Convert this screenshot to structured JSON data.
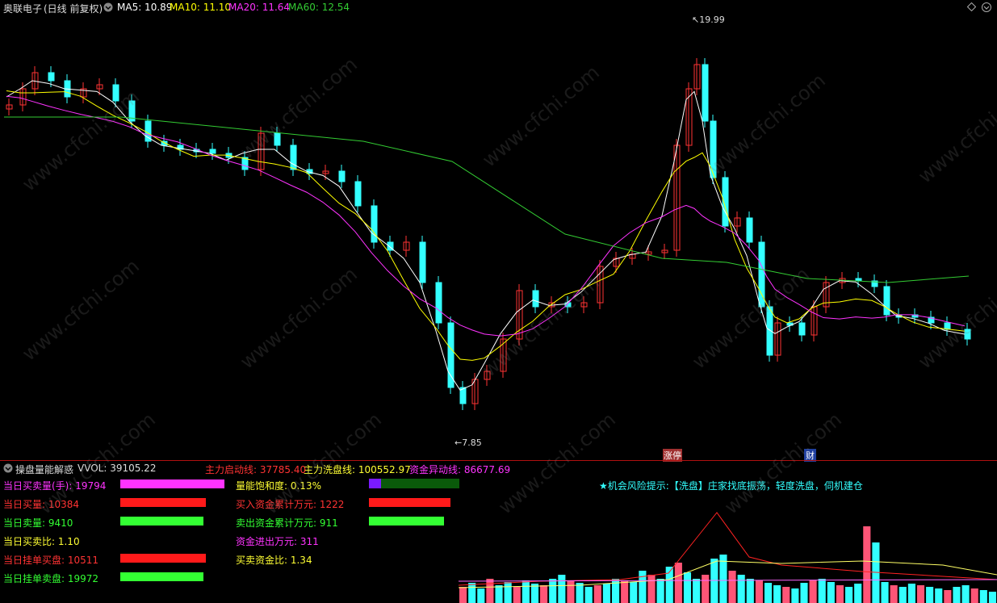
{
  "header": {
    "stock_name": "奥联电子",
    "period": "(日线 前复权)",
    "ma5": "MA5: 10.89",
    "ma10": "MA10: 11.10",
    "ma20": "MA20: 11.64",
    "ma60": "MA60: 12.54",
    "colors": {
      "ma5": "#ffffff",
      "ma10": "#ffff00",
      "ma20": "#ff33ff",
      "ma60": "#33cc33",
      "up": "#ff3333",
      "down": "#33ffff"
    }
  },
  "main_chart": {
    "high_label": "19.99",
    "low_label": "7.85",
    "event_tags": [
      "涨停",
      "财"
    ]
  },
  "indicator": {
    "name": "操盘量能解惑",
    "vvol": "VVOL: 39105.22",
    "zhuli_qidong": "主力启动线: 37785.40",
    "zhuli_xipan": "主力洗盘线: 100552.97",
    "zijin_yidong": "资金异动线: 86677.69"
  },
  "stats_left": [
    {
      "label": "当日买卖量(手): 19794",
      "color": "#ff33ff",
      "bar_color": "#ff33ff",
      "bar_fraction": 1.0
    },
    {
      "label": "当日买量: 10384",
      "color": "#ff3333",
      "bar_color": "#ff1a1a",
      "bar_fraction": 0.82
    },
    {
      "label": "当日卖量: 9410",
      "color": "#33ff33",
      "bar_color": "#33ff33",
      "bar_fraction": 0.8
    },
    {
      "label": "当日买卖比: 1.10",
      "color": "#ffff33",
      "bar_color": "",
      "bar_fraction": 0
    },
    {
      "label": "当日挂单买盘: 10511",
      "color": "#ff3333",
      "bar_color": "#ff1a1a",
      "bar_fraction": 0.82
    },
    {
      "label": "当日挂单卖盘: 19972",
      "color": "#33ff33",
      "bar_color": "#33ff33",
      "bar_fraction": 0.8
    }
  ],
  "stats_right": [
    {
      "label": "量能饱和度: 0.13%",
      "color": "#ffff33"
    },
    {
      "label": "买入资金累计万元: 1222",
      "color": "#ff3333"
    },
    {
      "label": "卖出资金累计万元: 911",
      "color": "#33ff33"
    },
    {
      "label": "资金进出万元: 311",
      "color": "#ff33ff"
    },
    {
      "label": "买卖资金比: 1.34",
      "color": "#ffff33"
    }
  ],
  "right_bars": [
    {
      "color": "#7a1aff",
      "fraction": 0.13,
      "bg": "#0a5a0a"
    },
    {
      "color": "#ff1a1a",
      "fraction": 0.9
    },
    {
      "color": "#33ff33",
      "fraction": 0.82
    }
  ],
  "tip": {
    "prefix": "★机会风险提示:",
    "text": "【洗盘】庄家找底振荡，轻度洗盘，伺机建仓"
  },
  "watermark": "www.cfchi.com"
}
